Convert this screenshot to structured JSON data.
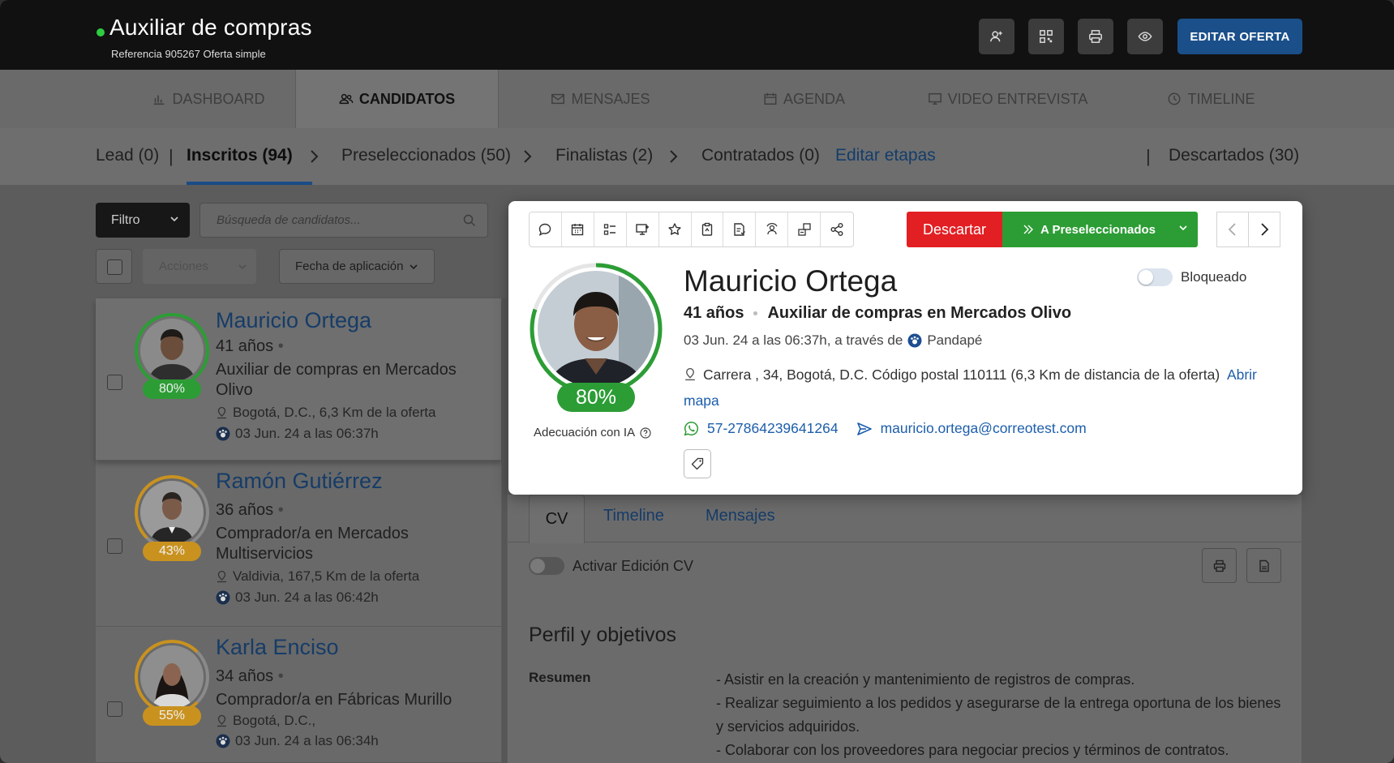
{
  "header": {
    "title": "Auxiliar de compras",
    "subtitle": "Referencia 905267 Oferta simple",
    "edit_button": "EDITAR OFERTA",
    "icon_buttons": [
      "add-user-icon",
      "qr-code-icon",
      "print-icon",
      "eye-icon"
    ]
  },
  "tabs": [
    {
      "label": "DASHBOARD",
      "icon": "bar-chart-icon"
    },
    {
      "label": "CANDIDATOS",
      "icon": "users-icon",
      "active": true
    },
    {
      "label": "MENSAJES",
      "icon": "mail-icon"
    },
    {
      "label": "AGENDA",
      "icon": "calendar-icon"
    },
    {
      "label": "VIDEO ENTREVISTA",
      "icon": "video-icon"
    },
    {
      "label": "TIMELINE",
      "icon": "clock-icon"
    }
  ],
  "stages": {
    "lead": "Lead (0)",
    "inscritos": "Inscritos (94)",
    "preseleccionados": "Preseleccionados (50)",
    "finalistas": "Finalistas (2)",
    "contratados": "Contratados (0)",
    "editar": "Editar etapas",
    "descartados": "Descartados (30)"
  },
  "filters": {
    "filtro": "Filtro",
    "search_placeholder": "Búsqueda de candidatos...",
    "acciones": "Acciones",
    "fecha": "Fecha de aplicación"
  },
  "candidates": [
    {
      "name": "Mauricio Ortega",
      "age": "41 años",
      "job1": "Auxiliar de compras en Mercados",
      "job2": "Olivo",
      "location": "Bogotá, D.C.,  6,3 Km de la oferta",
      "date": "03 Jun. 24 a las 06:37h",
      "match": "80%",
      "match_color": "#2c9d35"
    },
    {
      "name": "Ramón Gutiérrez",
      "age": "36 años",
      "job1": "Comprador/a en Mercados",
      "job2": "Multiservicios",
      "location": "Valdivia,  167,5 Km de la oferta",
      "date": "03 Jun. 24 a las 06:42h",
      "match": "43%",
      "match_color": "#c9921f"
    },
    {
      "name": "Karla Enciso",
      "age": "34 años",
      "job1": "Comprador/a en Fábricas Murillo",
      "job2": "",
      "location": "Bogotá, D.C.,",
      "date": "03 Jun. 24 a las 06:34h",
      "match": "55%",
      "match_color": "#c9921f"
    }
  ],
  "modal": {
    "discard": "Descartar",
    "advance": "A Preseleccionados",
    "name": "Mauricio Ortega",
    "age": "41 años",
    "job": "Auxiliar de compras en Mercados Olivo",
    "applied": "03 Jun. 24 a las 06:37h, a través de",
    "source": "Pandapé",
    "address": "Carrera , 34, Bogotá, D.C. Código postal 110111 (6,3 Km de distancia de la oferta)",
    "map_link": "Abrir mapa",
    "phone": "57-27864239641264",
    "email": "mauricio.ortega@correotest.com",
    "blocked_label": "Bloqueado",
    "match": "80%",
    "ai_label": "Adecuación con IA",
    "toolbar_icons": [
      "comment-icon",
      "calendar-icon",
      "checklist-icon",
      "video-call-icon",
      "star-icon",
      "clipboard-icon",
      "document-icon",
      "interview-icon",
      "transfer-icon",
      "share-icon"
    ]
  },
  "detail": {
    "tabs": [
      "CV",
      "Timeline",
      "Mensajes"
    ],
    "edit_cv": "Activar Edición CV",
    "section_title": "Perfil y objetivos",
    "resumen_label": "Resumen",
    "resumen_lines": [
      "- Asistir en la creación y mantenimiento de registros de compras.",
      "- Realizar seguimiento a los pedidos y asegurarse de la entrega oportuna de los bienes",
      "y servicios adquiridos.",
      "- Colaborar con los proveedores para negociar precios y términos de contratos."
    ]
  }
}
